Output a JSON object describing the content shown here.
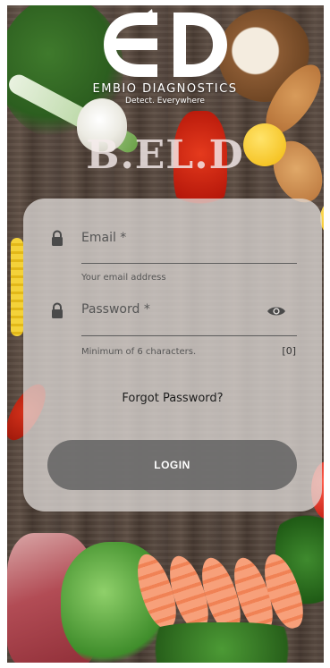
{
  "brand": {
    "name": "EMBIO DIAGNOSTICS",
    "tagline": "Detect. Everywhere",
    "logo_letters": "ED"
  },
  "app_title": "B.EL.D",
  "form": {
    "email": {
      "label": "Email *",
      "helper": "Your email address",
      "icon": "lock-icon"
    },
    "password": {
      "label": "Password *",
      "helper": "Minimum of 6 characters.",
      "counter": "[0]",
      "icon": "lock-icon",
      "toggle_icon": "eye-icon"
    },
    "forgot_link": "Forgot Password?",
    "login_button": "LOGIN"
  },
  "colors": {
    "card_bg": "#e2dedc",
    "button_bg": "#5f5f5f",
    "button_text": "#ffffff",
    "text_dark": "#1d1d1d",
    "text_muted": "#555555"
  }
}
